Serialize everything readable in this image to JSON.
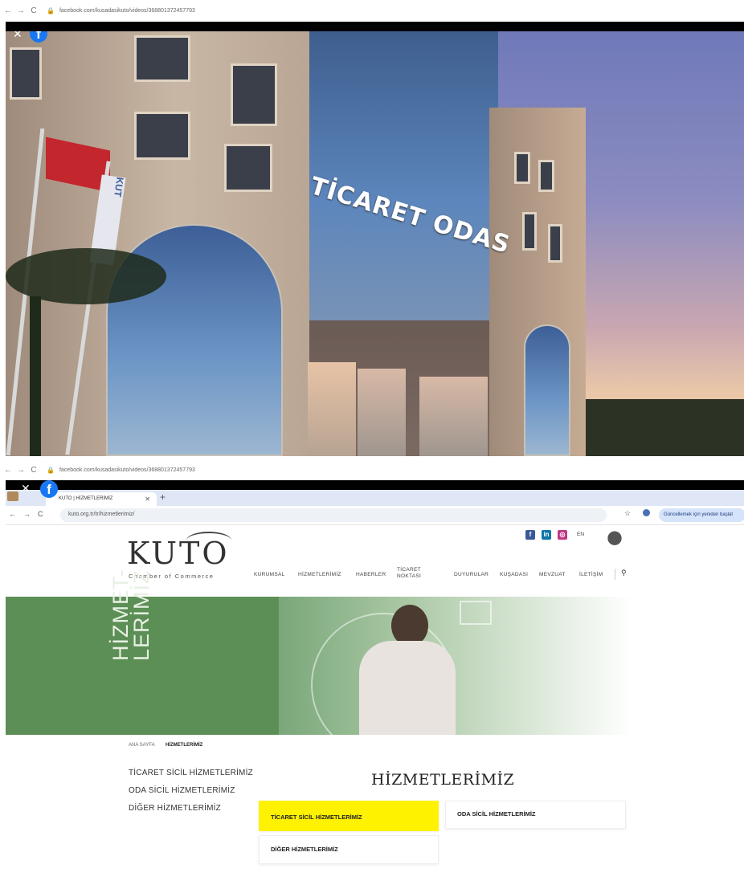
{
  "browser_top": {
    "url": "facebook.com/kusadasikuto/videos/368801372457793"
  },
  "video": {
    "sign_text_1": "TİCARET ODAS",
    "flag_text": "KUT"
  },
  "browser_mid": {
    "url": "facebook.com/kusadasikuto/videos/368801372457793"
  },
  "browser_inner": {
    "tab_title": "KUTO | HİZMETLERİMİZ",
    "address": "kuto.org.tr/tr/hizmetlerimiz/",
    "update_button": "Güncellemek için yeniden başlat"
  },
  "site": {
    "logo": "KUTO",
    "logo_sub": "Chamber of Commerce",
    "lang": "EN",
    "menu": [
      "KURUMSAL",
      "HİZMETLERİMİZ",
      "HABERLER",
      "TİCARET",
      "NOKTASI",
      "DUYURULAR",
      "KUŞADASI",
      "MEVZUAT",
      "İLETİŞİM"
    ],
    "hero_title": "HİZMET-\nLERİMİZ",
    "breadcrumb": {
      "home": "ANA SAYFA",
      "current": "HİZMETLERİMİZ"
    },
    "sidebar": [
      "TİCARET SİCİL HİZMETLERİMİZ",
      "ODA SİCİL HİZMETLERİMİZ",
      "DİĞER HİZMETLERİMİZ"
    ],
    "page_title": "HİZMETLERİMİZ",
    "cards": [
      "TİCARET SİCİL HİZMETLERİMİZ",
      "ODA SİCİL HİZMETLERİMİZ",
      "DİĞER HİZMETLERİMİZ"
    ]
  },
  "colors": {
    "facebook_blue": "#1877f2",
    "hero_green": "#5c8f55",
    "card_highlight": "#fff200"
  }
}
